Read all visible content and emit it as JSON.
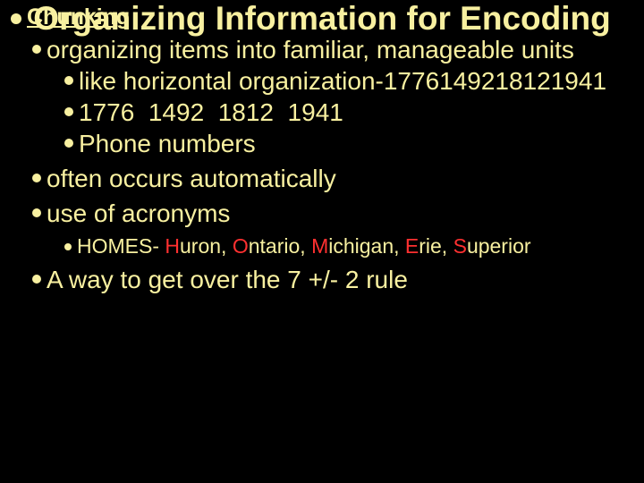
{
  "title": "Organizing Information for Encoding",
  "heading": "Chunking",
  "b1": "organizing items into familiar, manageable units",
  "b1a": "like horizontal organization-1776149218121941",
  "b1b": "1776  1492  1812  1941",
  "b1c": "Phone numbers",
  "b2": "often occurs automatically",
  "b3": "use of acronyms",
  "b3a_prefix": "HOMES- ",
  "b3a_h": "H",
  "b3a_1": "uron, ",
  "b3a_o": "O",
  "b3a_2": "ntario, ",
  "b3a_m": "M",
  "b3a_3": "ichigan, ",
  "b3a_e": "E",
  "b3a_4": "rie, ",
  "b3a_s": "S",
  "b3a_5": "uperior",
  "b4": "A way to get over the 7 +/- 2 rule"
}
